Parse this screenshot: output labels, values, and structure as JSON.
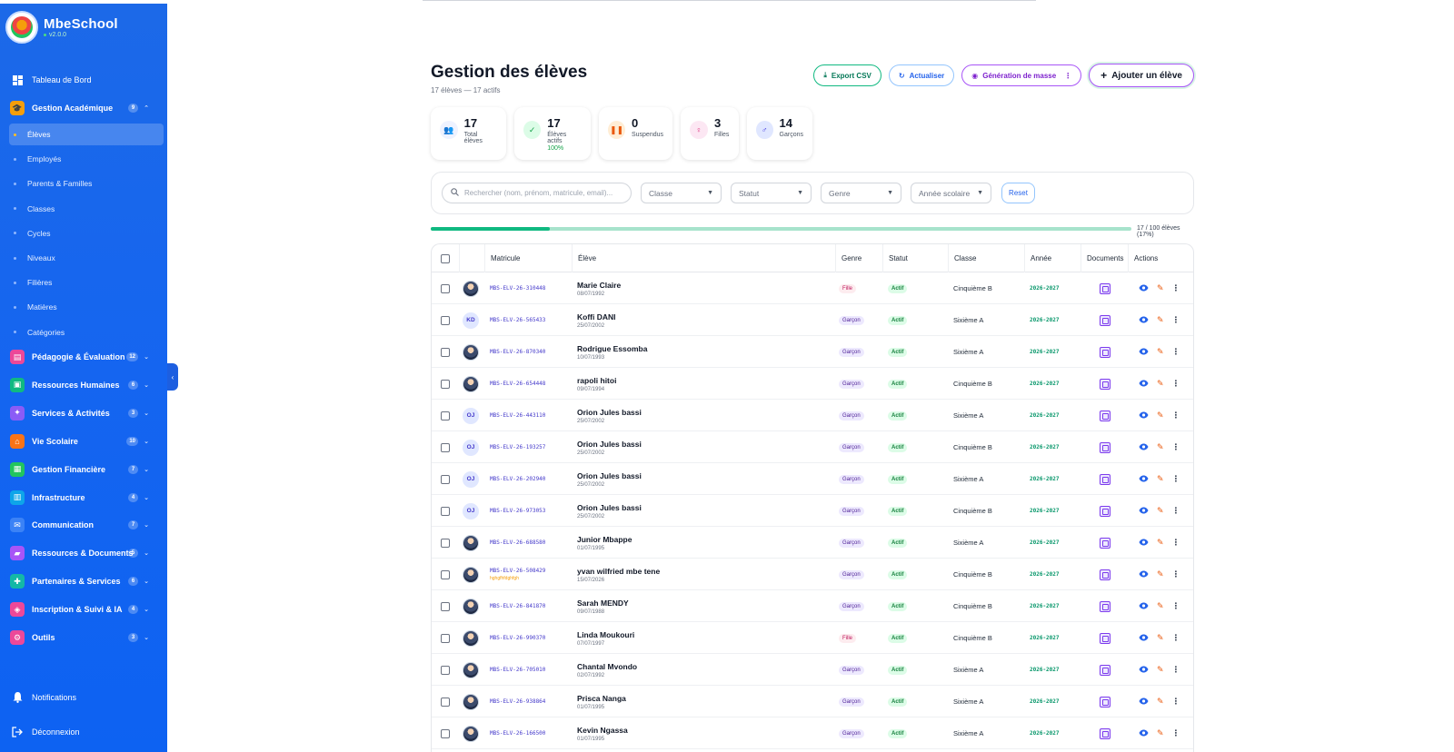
{
  "brand": {
    "name": "MbeSchool",
    "version": "v2.0.0"
  },
  "sidebar": {
    "dashboard": "Tableau de Bord",
    "academic": {
      "label": "Gestion Académique",
      "badge": "9"
    },
    "sub_items": [
      "Élèves",
      "Employés",
      "Parents & Familles",
      "Classes",
      "Cycles",
      "Niveaux",
      "Filières",
      "Matières",
      "Catégories"
    ],
    "groups": [
      {
        "label": "Pédagogie & Évaluation",
        "badge": "12",
        "color": "#ec4899",
        "icon": "book-icon"
      },
      {
        "label": "Ressources Humaines",
        "badge": "6",
        "color": "#10b981",
        "icon": "briefcase-icon"
      },
      {
        "label": "Services & Activités",
        "badge": "3",
        "color": "#8b5cf6",
        "icon": "activity-icon"
      },
      {
        "label": "Vie Scolaire",
        "badge": "10",
        "color": "#f97316",
        "icon": "school-icon"
      },
      {
        "label": "Gestion Financière",
        "badge": "7",
        "color": "#22c55e",
        "icon": "finance-icon"
      },
      {
        "label": "Infrastructure",
        "badge": "4",
        "color": "#0ea5e9",
        "icon": "building-icon"
      },
      {
        "label": "Communication",
        "badge": "7",
        "color": "#3b82f6",
        "icon": "mail-icon"
      },
      {
        "label": "Ressources & Documents",
        "badge": "5",
        "color": "#a855f7",
        "icon": "folder-icon"
      },
      {
        "label": "Partenaires & Services",
        "badge": "6",
        "color": "#14b8a6",
        "icon": "handshake-icon"
      },
      {
        "label": "Inscription & Suivi & IA",
        "badge": "4",
        "color": "#ec4899",
        "icon": "ai-icon"
      },
      {
        "label": "Outils",
        "badge": "3",
        "color": "#ec4899",
        "icon": "tools-icon"
      }
    ],
    "notifications": "Notifications",
    "logout": "Déconnexion"
  },
  "header": {
    "title": "Gestion des élèves",
    "subtitle": "17 élèves — 17 actifs",
    "export": "Export CSV",
    "refresh": "Actualiser",
    "mass_gen": "Génération de masse",
    "add": "Ajouter un élève"
  },
  "stats": [
    {
      "value": "17",
      "label": "Total élèves",
      "extra": "",
      "icon": "users-icon",
      "bg": "#eef2ff",
      "fg": "#4f46e5"
    },
    {
      "value": "17",
      "label": "Élèves actifs",
      "extra": "100%",
      "icon": "check-circle-icon",
      "bg": "#dcfce7",
      "fg": "#16a34a"
    },
    {
      "value": "0",
      "label": "Suspendus",
      "extra": "",
      "icon": "pause-icon",
      "bg": "#ffedd5",
      "fg": "#ea580c"
    },
    {
      "value": "3",
      "label": "Filles",
      "extra": "",
      "icon": "female-icon",
      "bg": "#fce7f3",
      "fg": "#db2777"
    },
    {
      "value": "14",
      "label": "Garçons",
      "extra": "",
      "icon": "male-icon",
      "bg": "#e0e7ff",
      "fg": "#4f46e5"
    }
  ],
  "filters": {
    "search_placeholder": "Rechercher (nom, prénom, matricule, email)...",
    "classe": "Classe",
    "statut": "Statut",
    "genre": "Genre",
    "annee": "Année scolaire",
    "reset": "Reset"
  },
  "progress": {
    "fraction": 0.17,
    "label": "17 / 100 élèves (17%)"
  },
  "table": {
    "headers": [
      "Matricule",
      "Élève",
      "Genre",
      "Statut",
      "Classe",
      "Année",
      "Documents",
      "Actions"
    ],
    "rows": [
      {
        "matricule": "MBS-ELV-26-310448",
        "name": "Marie Claire",
        "dob": "08/07/1992",
        "genre": "Fille",
        "statut": "Actif",
        "classe": "Cinquième B",
        "annee": "2026-2027",
        "avatar": "",
        "note": ""
      },
      {
        "matricule": "MBS-ELV-26-565433",
        "name": "Koffi DANI",
        "dob": "25/07/2002",
        "genre": "Garçon",
        "statut": "Actif",
        "classe": "Sixième A",
        "annee": "2026-2027",
        "avatar": "KD",
        "note": ""
      },
      {
        "matricule": "MBS-ELV-26-870340",
        "name": "Rodrigue Essomba",
        "dob": "10/07/1993",
        "genre": "Garçon",
        "statut": "Actif",
        "classe": "Sixième A",
        "annee": "2026-2027",
        "avatar": "",
        "note": ""
      },
      {
        "matricule": "MBS-ELV-26-654448",
        "name": "rapoli hitoi",
        "dob": "09/07/1994",
        "genre": "Garçon",
        "statut": "Actif",
        "classe": "Cinquième B",
        "annee": "2026-2027",
        "avatar": "",
        "note": ""
      },
      {
        "matricule": "MBS-ELV-26-443110",
        "name": "Orion Jules bassi",
        "dob": "25/07/2002",
        "genre": "Garçon",
        "statut": "Actif",
        "classe": "Sixième A",
        "annee": "2026-2027",
        "avatar": "OJ",
        "note": ""
      },
      {
        "matricule": "MBS-ELV-26-193257",
        "name": "Orion Jules bassi",
        "dob": "25/07/2002",
        "genre": "Garçon",
        "statut": "Actif",
        "classe": "Cinquième B",
        "annee": "2026-2027",
        "avatar": "OJ",
        "note": ""
      },
      {
        "matricule": "MBS-ELV-26-202940",
        "name": "Orion Jules bassi",
        "dob": "25/07/2002",
        "genre": "Garçon",
        "statut": "Actif",
        "classe": "Sixième A",
        "annee": "2026-2027",
        "avatar": "OJ",
        "note": ""
      },
      {
        "matricule": "MBS-ELV-26-973053",
        "name": "Orion Jules bassi",
        "dob": "25/07/2002",
        "genre": "Garçon",
        "statut": "Actif",
        "classe": "Cinquième B",
        "annee": "2026-2027",
        "avatar": "OJ",
        "note": ""
      },
      {
        "matricule": "MBS-ELV-26-688580",
        "name": "Junior Mbappe",
        "dob": "01/07/1995",
        "genre": "Garçon",
        "statut": "Actif",
        "classe": "Sixième A",
        "annee": "2026-2027",
        "avatar": "",
        "note": ""
      },
      {
        "matricule": "MBS-ELV-26-508429",
        "name": "yvan wilfried mbe tene",
        "dob": "15/07/2026",
        "genre": "Garçon",
        "statut": "Actif",
        "classe": "Cinquième B",
        "annee": "2026-2027",
        "avatar": "",
        "note": "hghgfhfdghfgh"
      },
      {
        "matricule": "MBS-ELV-26-841870",
        "name": "Sarah MENDY",
        "dob": "09/07/1988",
        "genre": "Garçon",
        "statut": "Actif",
        "classe": "Cinquième B",
        "annee": "2026-2027",
        "avatar": "",
        "note": ""
      },
      {
        "matricule": "MBS-ELV-26-990370",
        "name": "Linda Moukouri",
        "dob": "07/07/1997",
        "genre": "Fille",
        "statut": "Actif",
        "classe": "Cinquième B",
        "annee": "2026-2027",
        "avatar": "",
        "note": ""
      },
      {
        "matricule": "MBS-ELV-26-705010",
        "name": "Chantal Mvondo",
        "dob": "02/07/1992",
        "genre": "Garçon",
        "statut": "Actif",
        "classe": "Sixième A",
        "annee": "2026-2027",
        "avatar": "",
        "note": ""
      },
      {
        "matricule": "MBS-ELV-26-938864",
        "name": "Prisca Nanga",
        "dob": "01/07/1995",
        "genre": "Garçon",
        "statut": "Actif",
        "classe": "Sixième A",
        "annee": "2026-2027",
        "avatar": "",
        "note": ""
      },
      {
        "matricule": "MBS-ELV-26-166500",
        "name": "Kevin Ngassa",
        "dob": "01/07/1995",
        "genre": "Garçon",
        "statut": "Actif",
        "classe": "Sixième A",
        "annee": "2026-2027",
        "avatar": "",
        "note": ""
      }
    ]
  }
}
